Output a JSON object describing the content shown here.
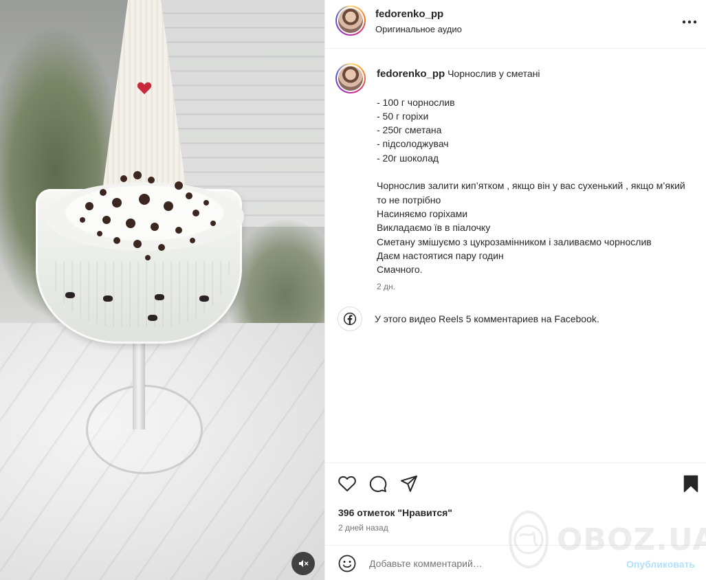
{
  "header": {
    "username": "fedorenko_pp",
    "subtitle": "Оригинальное аудио"
  },
  "caption": {
    "username": "fedorenko_pp",
    "text": "Чорнослив у сметані\n\n- 100 г чорнослив\n- 50 г горіхи\n- 250г сметана\n- підсолоджувач\n- 20г шоколад\n\nЧорнослив залити кип’ятком , якщо він у вас сухенький , якщо м’який то не потрібно\nНасиняємо горіхами\nВикладаємо їв в піалочку\nСметану змішуємо з цукрозамінником і заливаємо чорнослив\nДаєм настоятися пару годин\nСмачного.",
    "time": "2 дн."
  },
  "facebook": {
    "text": "У этого видео Reels 5 комментариев на Facebook."
  },
  "stats": {
    "likes": "396 отметок \"Нравится\"",
    "date": "2 дней назад"
  },
  "comment": {
    "placeholder": "Добавьте комментарий…",
    "post_label": "Опубликовать"
  },
  "watermark": {
    "text": "OBOZ.UA"
  },
  "icons": {
    "more": "more-icon",
    "like": "heart-icon",
    "comment": "comment-icon",
    "share": "share-icon",
    "save": "bookmark-icon",
    "emoji": "emoji-icon",
    "facebook": "facebook-icon",
    "mute": "muted-speaker-icon"
  },
  "colors": {
    "post_button": "#b2dffc",
    "secondary_text": "#737373",
    "primary_text": "#262626"
  }
}
